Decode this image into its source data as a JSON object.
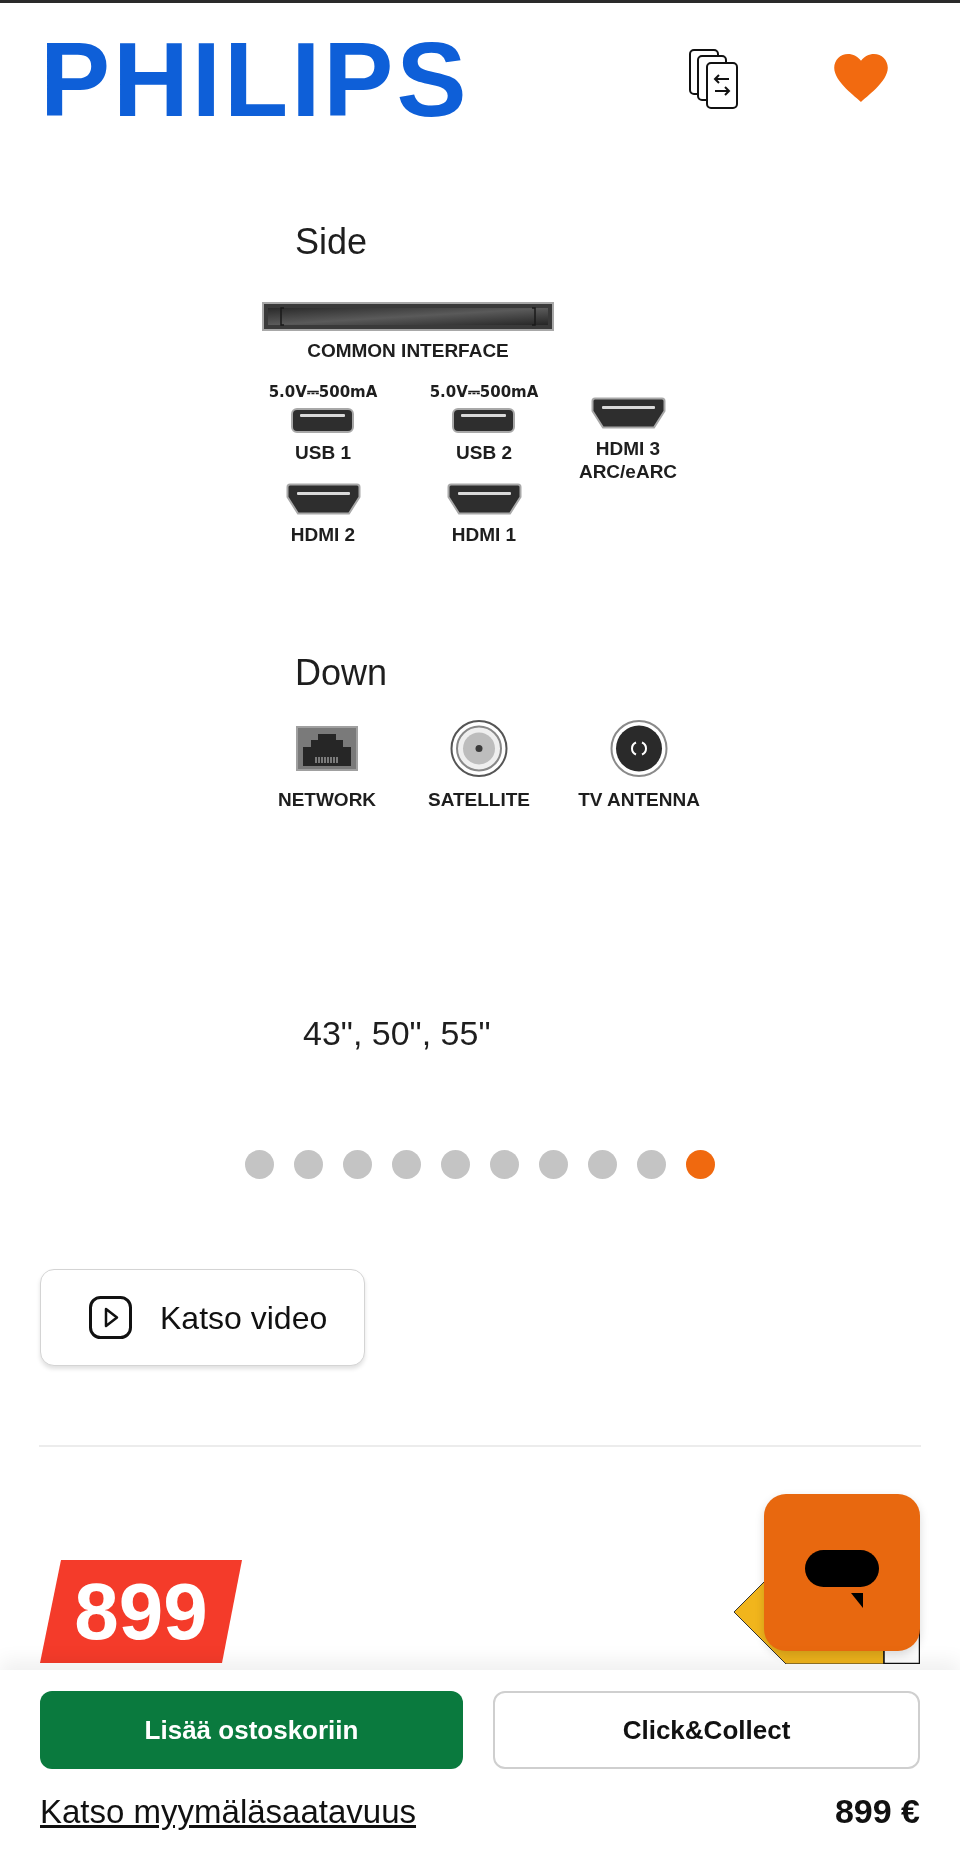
{
  "header": {
    "logo": "PHILIPS"
  },
  "product_image": {
    "side": {
      "title": "Side",
      "slot_label": "COMMON INTERFACE",
      "columns": [
        {
          "ports": [
            {
              "kind": "usb",
              "rating": "5.0V⎓500mA",
              "label": "USB 1"
            },
            {
              "kind": "hdmi",
              "label": "HDMI 2"
            }
          ]
        },
        {
          "ports": [
            {
              "kind": "usb",
              "rating": "5.0V⎓500mA",
              "label": "USB 2"
            },
            {
              "kind": "hdmi",
              "label": "HDMI 1"
            }
          ]
        },
        {
          "ports": [
            {
              "kind": "hdmi",
              "label": "HDMI 3",
              "sublabel": "ARC/eARC"
            }
          ]
        }
      ]
    },
    "down": {
      "title": "Down",
      "ports": [
        {
          "kind": "network",
          "label": "NETWORK"
        },
        {
          "kind": "satellite",
          "label": "SATELLITE"
        },
        {
          "kind": "antenna",
          "label": "TV ANTENNA"
        }
      ]
    },
    "sizes": "43\", 50\", 55\""
  },
  "carousel_dots": [
    {
      "selected": false
    },
    {
      "selected": false
    },
    {
      "selected": false
    },
    {
      "selected": false
    },
    {
      "selected": false
    },
    {
      "selected": false
    },
    {
      "selected": false
    },
    {
      "selected": false
    },
    {
      "selected": false
    },
    {
      "selected": true
    }
  ],
  "video_button": {
    "label": "Katso video"
  },
  "price_badge": "899",
  "bottom_bar": {
    "add_to_cart": "Lisää ostoskoriin",
    "click_collect": "Click&Collect",
    "store_availability_link": "Katso myymäläsaatavuus",
    "price": "899 €"
  }
}
